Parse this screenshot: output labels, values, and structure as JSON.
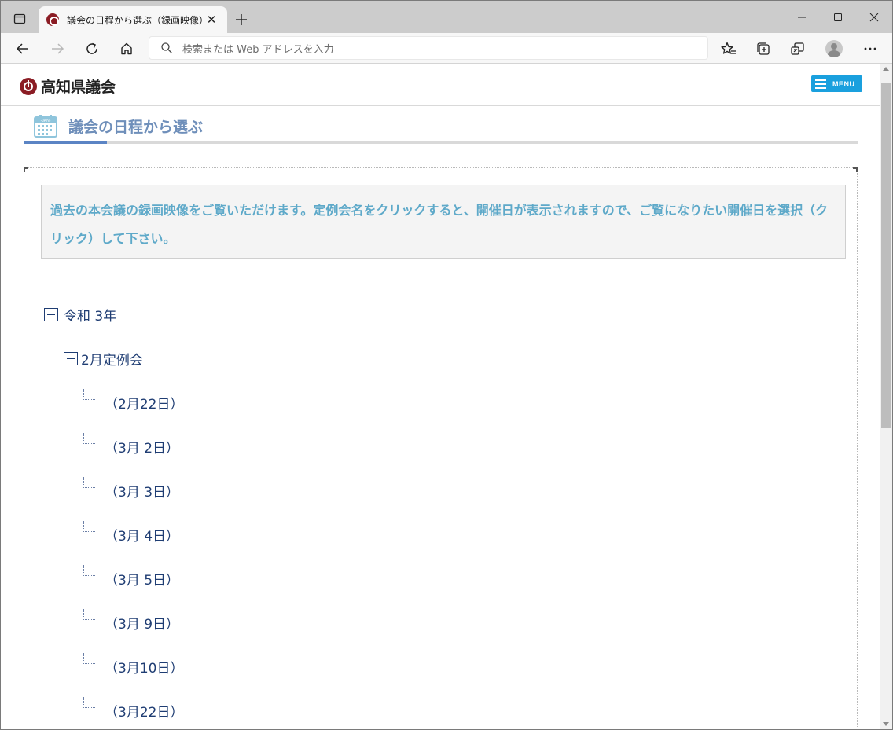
{
  "browser": {
    "tab_title": "議会の日程から選ぶ（録画映像）",
    "address_placeholder": "検索または Web アドレスを入力"
  },
  "site": {
    "logo_text": "高知県議会",
    "menu_label": "MENU",
    "section_heading": "議会の日程から選ぶ",
    "calendar_icon_label": "-JAN-",
    "notice_text": "過去の本会議の録画映像をご覧いただけます。定例会名をクリックすると、開催日が表示されますので、ご覧になりたい開催日を選択（クリック）して下さい。"
  },
  "tree": {
    "year_label": "令和 3年",
    "session_label": "2月定例会",
    "dates": [
      "（2月22日）",
      "（3月 2日）",
      "（3月 3日）",
      "（3月 4日）",
      "（3月 5日）",
      "（3月 9日）",
      "（3月10日）",
      "（3月22日）"
    ]
  },
  "colors": {
    "accent_blue": "#1aa0de",
    "heading_blue": "#6f8fba",
    "notice_text": "#5ea9c9",
    "link_navy": "#1f3d73",
    "logo_red": "#8b1c24"
  }
}
